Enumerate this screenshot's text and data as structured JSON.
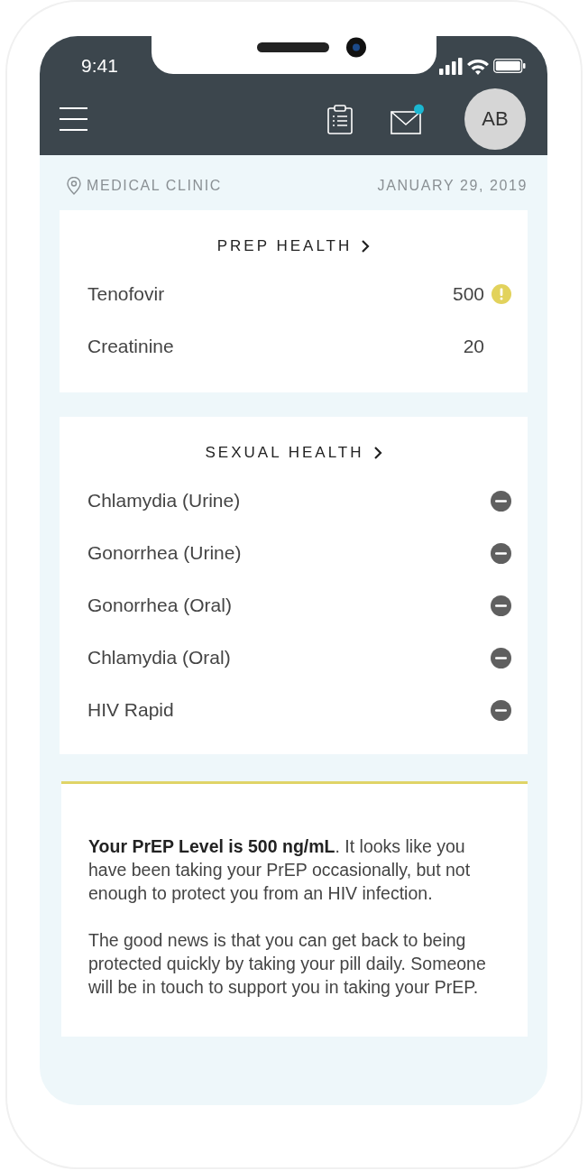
{
  "status_bar": {
    "time": "9:41"
  },
  "nav": {
    "avatar": "AB",
    "mail_unread": true
  },
  "location": "MEDICAL CLINIC",
  "date": "JANUARY 29, 2019",
  "prep_card": {
    "title": "PREP HEALTH",
    "rows": [
      {
        "name": "Tenofovir",
        "value": "500",
        "warning": true
      },
      {
        "name": "Creatinine",
        "value": "20",
        "warning": false
      }
    ]
  },
  "sexual_card": {
    "title": "SEXUAL HEALTH",
    "rows": [
      {
        "name": "Chlamydia (Urine)",
        "kind": "negative"
      },
      {
        "name": "Gonorrhea (Urine)",
        "kind": "negative"
      },
      {
        "name": "Gonorrhea (Oral)",
        "kind": "negative"
      },
      {
        "name": "Chlamydia (Oral)",
        "kind": "negative"
      },
      {
        "name": "HIV Rapid",
        "kind": "negative"
      }
    ]
  },
  "message": {
    "paragraphs": [
      "**Your PrEP Level is 500 ng/mL**. It looks like you have been taking your PrEP occasionally, but not enough to protect you from an HIV infection.",
      "The good news is that you can get back to being protected quickly by taking your pill daily. Someone will be in touch to support you in taking your PrEP."
    ]
  }
}
